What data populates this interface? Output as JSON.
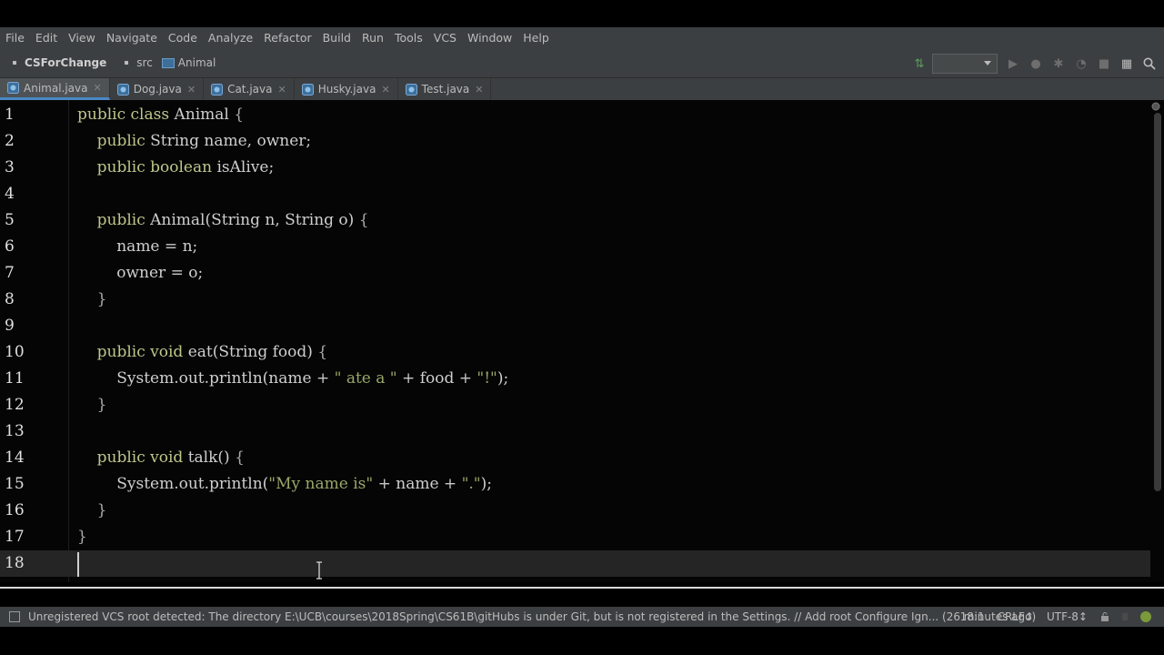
{
  "menu": [
    "File",
    "Edit",
    "View",
    "Navigate",
    "Code",
    "Analyze",
    "Refactor",
    "Build",
    "Run",
    "Tools",
    "VCS",
    "Window",
    "Help"
  ],
  "breadcrumb": {
    "project": "CSForChange",
    "folder": "src",
    "class": "Animal"
  },
  "tabs": [
    {
      "label": "Animal.java",
      "active": true
    },
    {
      "label": "Dog.java",
      "active": false
    },
    {
      "label": "Cat.java",
      "active": false
    },
    {
      "label": "Husky.java",
      "active": false
    },
    {
      "label": "Test.java",
      "active": false
    }
  ],
  "code": {
    "lines": [
      {
        "n": "1",
        "tokens": [
          [
            "kw",
            "public class "
          ],
          [
            "t",
            "Animal "
          ],
          [
            "brace",
            "{"
          ]
        ]
      },
      {
        "n": "2",
        "tokens": [
          [
            "t",
            "    "
          ],
          [
            "kw",
            "public "
          ],
          [
            "t",
            "String name, owner;"
          ]
        ]
      },
      {
        "n": "3",
        "tokens": [
          [
            "t",
            "    "
          ],
          [
            "kw",
            "public boolean "
          ],
          [
            "t",
            "isAlive;"
          ]
        ]
      },
      {
        "n": "4",
        "tokens": []
      },
      {
        "n": "5",
        "tokens": [
          [
            "t",
            "    "
          ],
          [
            "kw",
            "public "
          ],
          [
            "t",
            "Animal(String n, String o) "
          ],
          [
            "brace",
            "{"
          ]
        ]
      },
      {
        "n": "6",
        "tokens": [
          [
            "t",
            "        name "
          ],
          [
            "op",
            "= "
          ],
          [
            "t",
            "n;"
          ]
        ]
      },
      {
        "n": "7",
        "tokens": [
          [
            "t",
            "        owner "
          ],
          [
            "op",
            "= "
          ],
          [
            "t",
            "o;"
          ]
        ]
      },
      {
        "n": "8",
        "tokens": [
          [
            "t",
            "    "
          ],
          [
            "brace",
            "}"
          ]
        ]
      },
      {
        "n": "9",
        "tokens": []
      },
      {
        "n": "10",
        "tokens": [
          [
            "t",
            "    "
          ],
          [
            "kw",
            "public void "
          ],
          [
            "t",
            "eat(String food) "
          ],
          [
            "brace",
            "{"
          ]
        ]
      },
      {
        "n": "11",
        "tokens": [
          [
            "t",
            "        System.out.println(name "
          ],
          [
            "op",
            "+ "
          ],
          [
            "str",
            "\" ate a \" "
          ],
          [
            "op",
            "+ "
          ],
          [
            "t",
            "food "
          ],
          [
            "op",
            "+ "
          ],
          [
            "str",
            "\"!\""
          ],
          [
            "t",
            ");"
          ]
        ]
      },
      {
        "n": "12",
        "tokens": [
          [
            "t",
            "    "
          ],
          [
            "brace",
            "}"
          ]
        ]
      },
      {
        "n": "13",
        "tokens": []
      },
      {
        "n": "14",
        "tokens": [
          [
            "t",
            "    "
          ],
          [
            "kw",
            "public void "
          ],
          [
            "t",
            "talk() "
          ],
          [
            "brace",
            "{"
          ]
        ]
      },
      {
        "n": "15",
        "tokens": [
          [
            "t",
            "        System.out.println("
          ],
          [
            "str",
            "\"My name is\" "
          ],
          [
            "op",
            "+ "
          ],
          [
            "t",
            "name "
          ],
          [
            "op",
            "+ "
          ],
          [
            "str",
            "\".\""
          ],
          [
            "t",
            ");"
          ]
        ]
      },
      {
        "n": "16",
        "tokens": [
          [
            "t",
            "    "
          ],
          [
            "brace",
            "}"
          ]
        ]
      },
      {
        "n": "17",
        "tokens": [
          [
            "brace",
            "}"
          ]
        ]
      },
      {
        "n": "18",
        "tokens": []
      }
    ],
    "current_line": "18"
  },
  "status": {
    "message": "Unregistered VCS root detected: The directory E:\\UCB\\courses\\2018Spring\\CS61B\\gitHubs is under Git, but is not registered in the Settings. // Add root  Configure  Ign... (26 minutes ago)",
    "position": "18:1",
    "line_separator": "CRLF↕",
    "encoding": "UTF-8↕"
  },
  "colors": {
    "keyword": "#bfc68a",
    "string": "#9aa76a",
    "editor_bg": "#050505",
    "ui_bg": "#3c3f41"
  }
}
